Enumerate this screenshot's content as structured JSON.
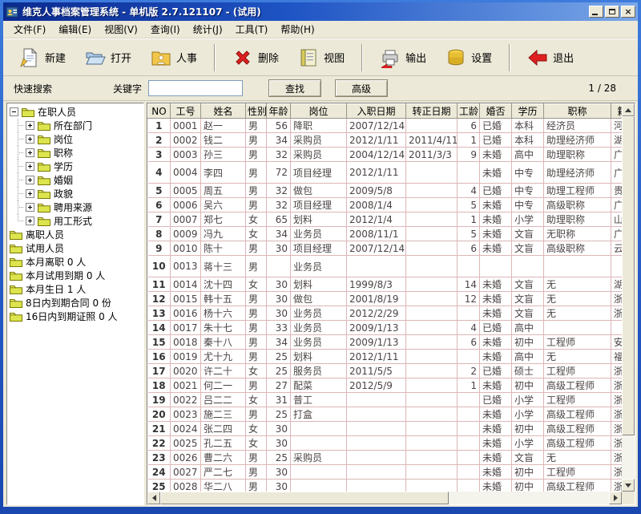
{
  "window": {
    "title": "维克人事档案管理系统 - 单机版 2.7.121107 - (试用)"
  },
  "menu": {
    "items": [
      "文件(F)",
      "编辑(E)",
      "视图(V)",
      "查询(I)",
      "统计(J)",
      "工具(T)",
      "帮助(H)"
    ]
  },
  "toolbar": {
    "buttons": [
      {
        "label": "新建",
        "icon": "new-document-icon"
      },
      {
        "label": "打开",
        "icon": "open-folder-icon"
      },
      {
        "label": "人事",
        "icon": "personnel-folder-icon"
      },
      {
        "label": "删除",
        "icon": "delete-x-icon"
      },
      {
        "label": "视图",
        "icon": "view-notebook-icon"
      },
      {
        "label": "输出",
        "icon": "output-printer-icon"
      },
      {
        "label": "设置",
        "icon": "settings-stack-icon"
      },
      {
        "label": "退出",
        "icon": "exit-arrow-icon"
      }
    ]
  },
  "search": {
    "quick_label": "快速搜索",
    "keyword_label": "关键字",
    "input_value": "",
    "find_label": "查找",
    "advanced_label": "高级",
    "counter": "1 / 28"
  },
  "tree": {
    "items": [
      {
        "label": "在职人员",
        "level": 0,
        "expand": "minus"
      },
      {
        "label": "所在部门",
        "level": 1,
        "expand": "plus"
      },
      {
        "label": "岗位",
        "level": 1,
        "expand": "plus"
      },
      {
        "label": "职称",
        "level": 1,
        "expand": "plus"
      },
      {
        "label": "学历",
        "level": 1,
        "expand": "plus"
      },
      {
        "label": "婚姻",
        "level": 1,
        "expand": "plus"
      },
      {
        "label": "政貌",
        "level": 1,
        "expand": "plus"
      },
      {
        "label": "聘用来源",
        "level": 1,
        "expand": "plus"
      },
      {
        "label": "用工形式",
        "level": 1,
        "expand": "plus"
      },
      {
        "label": "离职人员",
        "level": 0,
        "expand": "none"
      },
      {
        "label": "试用人员",
        "level": 0,
        "expand": "none"
      },
      {
        "label": "本月离职 0 人",
        "level": 0,
        "expand": "none"
      },
      {
        "label": "本月试用到期 0 人",
        "level": 0,
        "expand": "none"
      },
      {
        "label": "本月生日 1 人",
        "level": 0,
        "expand": "none"
      },
      {
        "label": "8日内到期合同 0 份",
        "level": 0,
        "expand": "none"
      },
      {
        "label": "16日内到期证照 0 人",
        "level": 0,
        "expand": "none"
      }
    ]
  },
  "table": {
    "columns": [
      "NO",
      "工号",
      "姓名",
      "性别",
      "年龄",
      "岗位",
      "入职日期",
      "转正日期",
      "工龄",
      "婚否",
      "学历",
      "职称",
      "籍贯"
    ],
    "rows": [
      [
        "1",
        "0001",
        "赵一",
        "男",
        "56",
        "降职",
        "2007/12/14",
        "",
        "6",
        "已婚",
        "本科",
        "经济员",
        "河"
      ],
      [
        "2",
        "0002",
        "钱二",
        "男",
        "34",
        "采购员",
        "2012/1/11",
        "2011/4/11",
        "1",
        "已婚",
        "本科",
        "助理经济师",
        "湖"
      ],
      [
        "3",
        "0003",
        "孙三",
        "男",
        "32",
        "采购员",
        "2004/12/14",
        "2011/3/3",
        "9",
        "未婚",
        "高中",
        "助理职称",
        "广"
      ],
      [
        "4",
        "0004",
        "李四",
        "男",
        "72",
        "项目经理",
        "2012/1/11",
        "",
        "",
        "未婚",
        "中专",
        "助理经济师",
        "广"
      ],
      [
        "5",
        "0005",
        "周五",
        "男",
        "32",
        "做包",
        "2009/5/8",
        "",
        "4",
        "已婚",
        "中专",
        "助理工程师",
        "贵"
      ],
      [
        "6",
        "0006",
        "吴六",
        "男",
        "32",
        "项目经理",
        "2008/1/4",
        "",
        "5",
        "未婚",
        "中专",
        "高级职称",
        "广"
      ],
      [
        "7",
        "0007",
        "郑七",
        "女",
        "65",
        "划料",
        "2012/1/4",
        "",
        "1",
        "未婚",
        "小学",
        "助理职称",
        "山"
      ],
      [
        "8",
        "0009",
        "冯九",
        "女",
        "34",
        "业务员",
        "2008/11/1",
        "",
        "5",
        "未婚",
        "文盲",
        "无职称",
        "广"
      ],
      [
        "9",
        "0010",
        "陈十",
        "男",
        "30",
        "项目经理",
        "2007/12/14",
        "",
        "6",
        "未婚",
        "文盲",
        "高级职称",
        "云"
      ],
      [
        "10",
        "0013",
        "蒋十三",
        "男",
        "",
        "业务员",
        "",
        "",
        "",
        "",
        "",
        "",
        ""
      ],
      [
        "11",
        "0014",
        "沈十四",
        "女",
        "30",
        "划料",
        "1999/8/3",
        "",
        "14",
        "未婚",
        "文盲",
        "无",
        "湖"
      ],
      [
        "12",
        "0015",
        "韩十五",
        "男",
        "30",
        "做包",
        "2001/8/19",
        "",
        "12",
        "未婚",
        "文盲",
        "无",
        "浙"
      ],
      [
        "13",
        "0016",
        "杨十六",
        "男",
        "30",
        "业务员",
        "2012/2/29",
        "",
        "",
        "未婚",
        "文盲",
        "无",
        "浙"
      ],
      [
        "14",
        "0017",
        "朱十七",
        "男",
        "33",
        "业务员",
        "2009/1/13",
        "",
        "4",
        "已婚",
        "高中",
        "",
        ""
      ],
      [
        "15",
        "0018",
        "秦十八",
        "男",
        "34",
        "业务员",
        "2009/1/13",
        "",
        "6",
        "未婚",
        "初中",
        "工程师",
        "安"
      ],
      [
        "16",
        "0019",
        "尤十九",
        "男",
        "25",
        "划料",
        "2012/1/11",
        "",
        "",
        "未婚",
        "高中",
        "无",
        "福"
      ],
      [
        "17",
        "0020",
        "许二十",
        "女",
        "25",
        "服务员",
        "2011/5/5",
        "",
        "2",
        "已婚",
        "硕士",
        "工程师",
        "浙"
      ],
      [
        "18",
        "0021",
        "何二一",
        "男",
        "27",
        "配菜",
        "2012/5/9",
        "",
        "1",
        "未婚",
        "初中",
        "高级工程师",
        "浙"
      ],
      [
        "19",
        "0022",
        "吕二二",
        "女",
        "31",
        "普工",
        "",
        "",
        "",
        "已婚",
        "小学",
        "工程师",
        "浙"
      ],
      [
        "20",
        "0023",
        "施二三",
        "男",
        "25",
        "打盒",
        "",
        "",
        "",
        "未婚",
        "小学",
        "高级工程师",
        "浙"
      ],
      [
        "21",
        "0024",
        "张二四",
        "女",
        "30",
        "",
        "",
        "",
        "",
        "未婚",
        "初中",
        "高级工程师",
        "浙"
      ],
      [
        "22",
        "0025",
        "孔二五",
        "女",
        "30",
        "",
        "",
        "",
        "",
        "未婚",
        "小学",
        "高级工程师",
        "浙"
      ],
      [
        "23",
        "0026",
        "曹二六",
        "男",
        "25",
        "采购员",
        "",
        "",
        "",
        "未婚",
        "文盲",
        "无",
        "浙"
      ],
      [
        "24",
        "0027",
        "严二七",
        "男",
        "30",
        "",
        "",
        "",
        "",
        "未婚",
        "初中",
        "工程师",
        "浙"
      ],
      [
        "25",
        "0028",
        "华二八",
        "男",
        "30",
        "",
        "",
        "",
        "",
        "未婚",
        "初中",
        "高级工程师",
        "浙"
      ]
    ]
  }
}
